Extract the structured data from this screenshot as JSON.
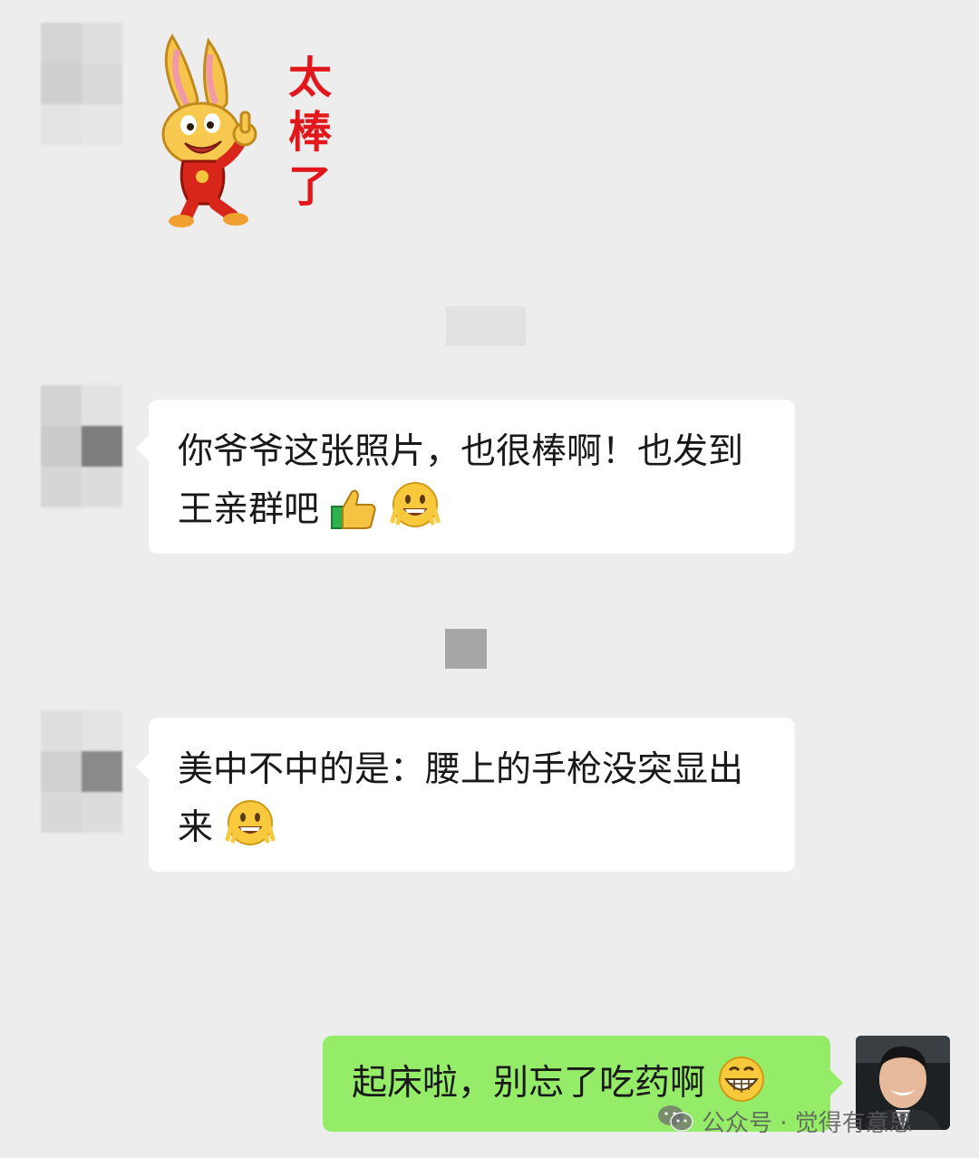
{
  "colors": {
    "background": "#ededed",
    "bubble_incoming": "#ffffff",
    "bubble_outgoing": "#95ec69",
    "text": "#191919"
  },
  "sticker": {
    "caption": "太棒了",
    "icon": "rabbit-thumbs-up-sticker"
  },
  "messages": [
    {
      "sender": "other",
      "text": "你爷爷这张照片，也很棒啊！也发到王亲群吧",
      "trailing_emojis": [
        "thumbs-up-icon",
        "grin-peace-icon"
      ]
    },
    {
      "sender": "other",
      "text": "美中不中的是：腰上的手枪没突显出来",
      "trailing_emojis": [
        "grin-peace-icon"
      ]
    },
    {
      "sender": "self",
      "text": "起床啦，别忘了吃药啊",
      "trailing_emojis": [
        "grinning-teeth-icon"
      ]
    }
  ],
  "watermark": {
    "icon": "wechat-icon",
    "text": "公众号 · 觉得有意思"
  }
}
